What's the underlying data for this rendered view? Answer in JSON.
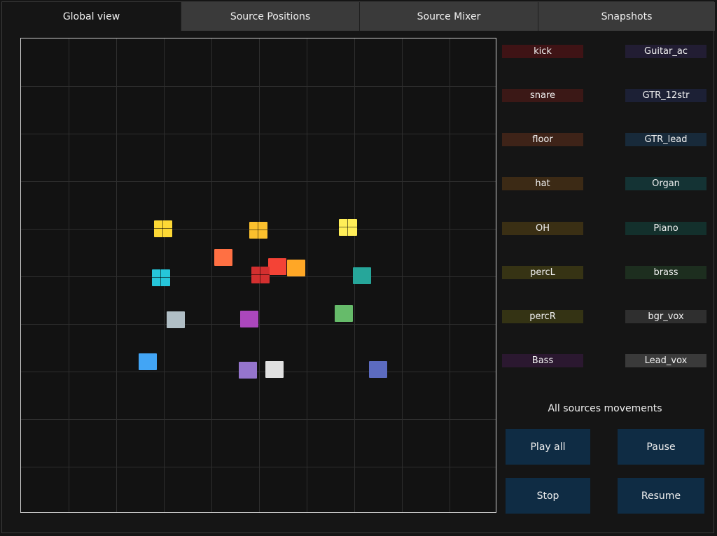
{
  "tabs": [
    {
      "label": "Global view",
      "active": true
    },
    {
      "label": "Source Positions",
      "active": false
    },
    {
      "label": "Source Mixer",
      "active": false
    },
    {
      "label": "Snapshots",
      "active": false
    }
  ],
  "sources_left": [
    {
      "label": "kick",
      "color": "#3f1315"
    },
    {
      "label": "snare",
      "color": "#3b1816"
    },
    {
      "label": "floor",
      "color": "#3e2318"
    },
    {
      "label": "hat",
      "color": "#3c2a15"
    },
    {
      "label": "OH",
      "color": "#3a2f14"
    },
    {
      "label": "percL",
      "color": "#363314"
    },
    {
      "label": "percR",
      "color": "#343314"
    },
    {
      "label": "Bass",
      "color": "#2b1830"
    }
  ],
  "sources_right": [
    {
      "label": "Guitar_ac",
      "color": "#221d33"
    },
    {
      "label": "GTR_12str",
      "color": "#1c2035"
    },
    {
      "label": "GTR_lead",
      "color": "#182a3a"
    },
    {
      "label": "Organ",
      "color": "#143334"
    },
    {
      "label": "Piano",
      "color": "#13302c"
    },
    {
      "label": "brass",
      "color": "#1d2e1f"
    },
    {
      "label": "bgr_vox",
      "color": "#2f2f2f"
    },
    {
      "label": "Lead_vox",
      "color": "#3a3a3a"
    }
  ],
  "markers": [
    {
      "color": "#fdd835",
      "cross": true
    },
    {
      "color": "#fbc02d",
      "cross": true
    },
    {
      "color": "#ffee58",
      "cross": true
    },
    {
      "color": "#ff7043",
      "cross": false
    },
    {
      "color": "#f44336",
      "cross": false
    },
    {
      "color": "#ffa726",
      "cross": false
    },
    {
      "color": "#d32f2f",
      "cross": true
    },
    {
      "color": "#26c6da",
      "cross": true
    },
    {
      "color": "#26a69a",
      "cross": false
    },
    {
      "color": "#b0bec5",
      "cross": false
    },
    {
      "color": "#ab47bc",
      "cross": false
    },
    {
      "color": "#66bb6a",
      "cross": false
    },
    {
      "color": "#42a5f5",
      "cross": false
    },
    {
      "color": "#9575cd",
      "cross": false
    },
    {
      "color": "#e0e0e0",
      "cross": false
    },
    {
      "color": "#5c6bc0",
      "cross": false
    }
  ],
  "movements": {
    "title": "All sources movements",
    "play_all": "Play all",
    "pause": "Pause",
    "stop": "Stop",
    "resume": "Resume"
  }
}
